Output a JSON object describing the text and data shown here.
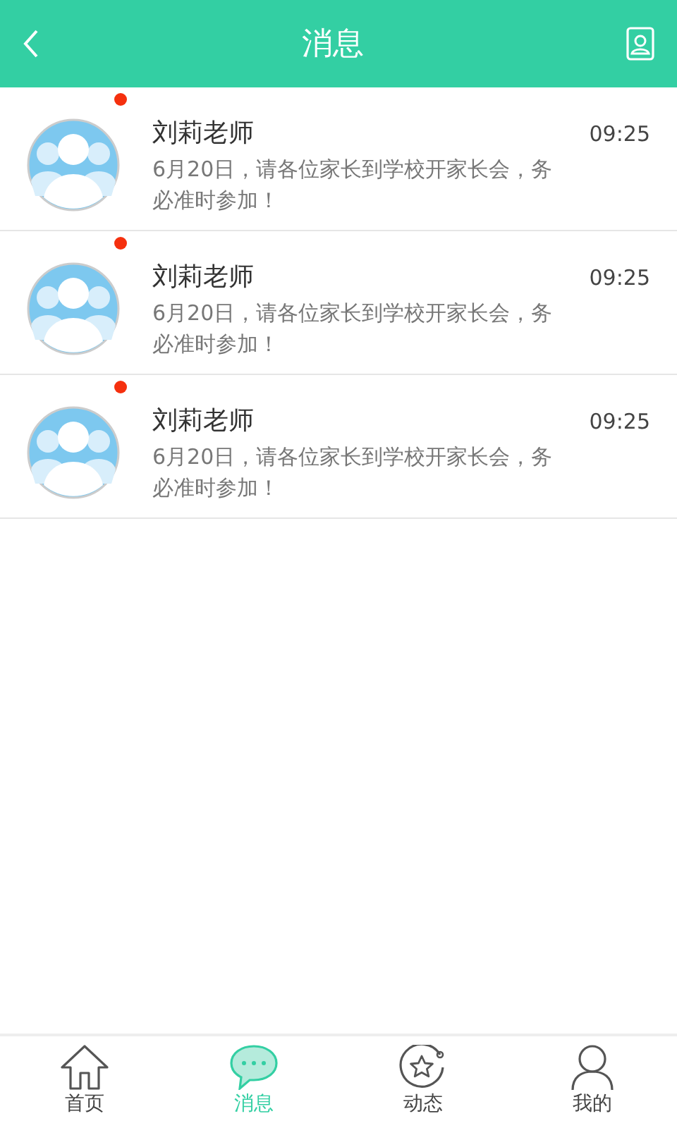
{
  "header": {
    "title": "消息"
  },
  "messages": [
    {
      "sender": "刘莉老师",
      "time": "09:25",
      "text": "6月20日，请各位家长到学校开家长会，务必准时参加！",
      "unread": true
    },
    {
      "sender": "刘莉老师",
      "time": "09:25",
      "text": "6月20日，请各位家长到学校开家长会，务必准时参加！",
      "unread": true
    },
    {
      "sender": "刘莉老师",
      "time": "09:25",
      "text": "6月20日，请各位家长到学校开家长会，务必准时参加！",
      "unread": true
    }
  ],
  "tabs": [
    {
      "label": "首页",
      "kind": "home",
      "selected": false
    },
    {
      "label": "消息",
      "kind": "chat",
      "selected": true
    },
    {
      "label": "动态",
      "kind": "star",
      "selected": false
    },
    {
      "label": "我的",
      "kind": "person",
      "selected": false
    }
  ]
}
